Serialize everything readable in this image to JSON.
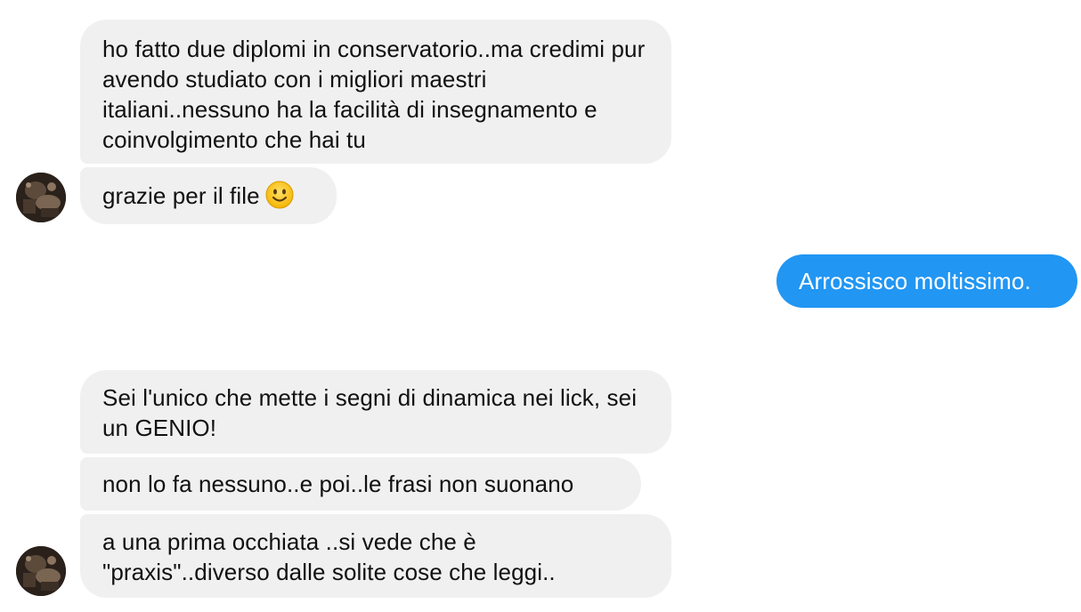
{
  "conversation": {
    "messages": [
      {
        "sender": "contact",
        "text": "ho fatto due diplomi in conservatorio..ma credimi pur avendo studiato con i migliori maestri italiani..nessuno ha la facilità di insegnamento e coinvolgimento che hai tu"
      },
      {
        "sender": "contact",
        "text": "grazie per il file",
        "emoji": "slightly-smiling-face-icon"
      },
      {
        "sender": "me",
        "text": "Arrossisco moltissimo."
      },
      {
        "sender": "contact",
        "text": "Sei l'unico che mette i segni di dinamica nei lick, sei un GENIO!"
      },
      {
        "sender": "contact",
        "text": "non lo fa nessuno..e poi..le frasi non suonano"
      },
      {
        "sender": "contact",
        "text": "a una prima occhiata ..si vede che è \"praxis\"..diverso dalle solite cose che leggi.."
      }
    ]
  },
  "colors": {
    "incoming_bubble": "#f0f0f0",
    "outgoing_bubble": "#2196f3",
    "outgoing_text": "#ffffff",
    "incoming_text": "#111111"
  }
}
